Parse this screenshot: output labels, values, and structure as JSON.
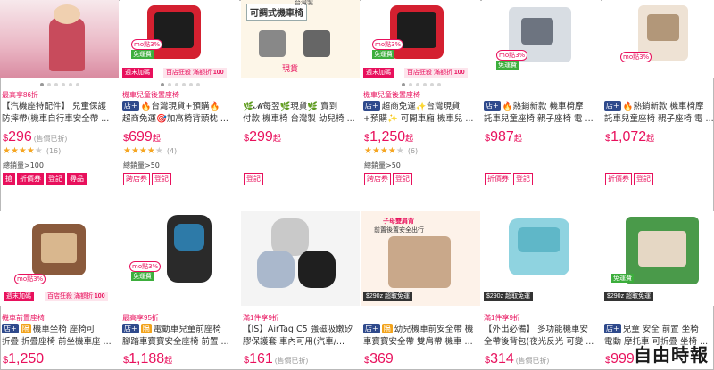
{
  "products": [
    {
      "promo": "最高享86折",
      "title_lines": [
        "【汽機座特配件】 兒童保護",
        "防摔帶(機車自行車安全帶 ..."
      ],
      "tag": "",
      "price": "296",
      "price_suffix": "",
      "price_note": "(售價已折)",
      "rating": 4,
      "review_count": "(16)",
      "sold": "總銷量>100",
      "badges": [
        "搶",
        "折價券",
        "登記",
        "尋品"
      ],
      "overlays": []
    },
    {
      "promo": "機車兒童後置座椅",
      "title_lines": [
        "超商免運🎯加高椅背頭枕 ..."
      ],
      "title_first": "🔥台灣現貨+預購🔥",
      "tag": "店+",
      "price": "699",
      "price_suffix": "起",
      "price_note": "",
      "rating": 4,
      "review_count": "(4)",
      "sold": "總銷量>50",
      "badges": [
        "跨店券",
        "登記"
      ],
      "overlays": [
        "mo點3%",
        "免運費",
        "週末加碼",
        "百店狂殺 滿額折",
        "100"
      ]
    },
    {
      "promo": "",
      "title_lines": [
        "🌿𝓜每翌🌿現貨🌿 賣到",
        "付款 機車椅 台灣製 幼兒椅 ..."
      ],
      "tag": "",
      "price": "299",
      "price_suffix": "起",
      "price_note": "",
      "rating": 0,
      "review_count": "",
      "sold": "",
      "badges": [
        "登記"
      ],
      "overlays": [
        "可調式機車椅",
        "台灣製",
        "現貨"
      ]
    },
    {
      "promo": "機車兒童後置座椅",
      "title_lines": [
        "+預購✨ 可開車廂 機車兒 ..."
      ],
      "title_first": "超商免運✨台灣現貨",
      "tag": "店+",
      "price": "1,250",
      "price_suffix": "起",
      "price_note": "",
      "rating": 4,
      "review_count": "(6)",
      "sold": "總銷量>50",
      "badges": [
        "跨店券",
        "登記"
      ],
      "overlays": [
        "mo點3%",
        "免運費",
        "週末加碼",
        "百店狂殺 滿額折",
        "100"
      ]
    },
    {
      "promo": "",
      "title_lines": [
        "託車兒童座椅 親子座椅 電 ..."
      ],
      "title_first": "🔥熱銷新款 機車椅摩",
      "tag": "店+",
      "price": "987",
      "price_suffix": "起",
      "price_note": "",
      "rating": 0,
      "review_count": "",
      "sold": "",
      "badges": [
        "折價券",
        "登記"
      ],
      "overlays": [
        "mo點3%",
        "免運費"
      ]
    },
    {
      "promo": "",
      "title_lines": [
        "託車兒童座椅 親子座椅 電 ..."
      ],
      "title_first": "🔥熱銷新款 機車椅摩",
      "tag": "店+",
      "price": "1,072",
      "price_suffix": "起",
      "price_note": "",
      "rating": 0,
      "review_count": "",
      "sold": "",
      "badges": [
        "折價券",
        "登記"
      ],
      "overlays": [
        "mo點3%"
      ]
    },
    {
      "promo": "機車前置座椅",
      "title_lines": [
        "折疊 折疊座椅 前坐機車座 ..."
      ],
      "title_first": "機車坐椅 座椅可",
      "tag": "店+",
      "tag2": "隔",
      "price": "1,250",
      "price_suffix": "",
      "price_note": "",
      "rating": 0,
      "review_count": "",
      "sold": "",
      "badges": [],
      "overlays": [
        "mo點3%",
        "週末加碼",
        "百店狂殺 滿額折",
        "100"
      ]
    },
    {
      "promo": "最高享95折",
      "title_lines": [
        "腳踏車寶寶安全座椅 前置 ..."
      ],
      "title_first": "電動車兒童前座椅",
      "tag": "店+",
      "tag2": "隔",
      "price": "1,188",
      "price_suffix": "起",
      "price_note": "",
      "rating": 0,
      "review_count": "",
      "sold": "",
      "badges": [],
      "overlays": [
        "mo點3%",
        "免運費"
      ]
    },
    {
      "promo": "滿1件享9折",
      "title_lines": [
        "【IS】AirTag C5 強磁吸嫩矽",
        "膠保護套 車內可用(汽車/..."
      ],
      "tag": "",
      "price": "161",
      "price_suffix": "",
      "price_note": "(售價已折)",
      "rating": 0,
      "review_count": "",
      "sold": "",
      "badges": [],
      "overlays": []
    },
    {
      "promo": "",
      "title_lines": [
        "車寶寶安全帶 雙肩帶 機車 ..."
      ],
      "title_first": "幼兒機車前安全帶 機",
      "tag": "店+",
      "tag2": "隔",
      "price": "369",
      "price_suffix": "",
      "price_note": "",
      "rating": 0,
      "review_count": "",
      "sold": "",
      "badges": [],
      "overlays": [
        "子母雙肩背",
        "前置後置安全出行",
        "$290z 超取免運"
      ]
    },
    {
      "promo": "滿1件享9折",
      "title_lines": [
        "【外出必備】 多功能機車安",
        "全帶後背包(夜光反光 可變 ..."
      ],
      "tag": "",
      "price": "314",
      "price_suffix": "",
      "price_note": "(售價已折)",
      "rating": 0,
      "review_count": "",
      "sold": "",
      "badges": [],
      "overlays": [
        "$290z 超取免運"
      ]
    },
    {
      "promo": "",
      "title_lines": [
        "電動 摩托車 可折疊 坐椅 ..."
      ],
      "title_first": "兒童 安全 前置 坐椅",
      "tag": "店+",
      "price": "999",
      "price_suffix": "",
      "price_note": "",
      "rating": 0,
      "review_count": "",
      "sold": "",
      "badges": [],
      "overlays": [
        "免運費",
        "$290z 超取免運"
      ]
    }
  ],
  "watermark": "自由時報",
  "colors": {
    "accent": "#e8105c",
    "star": "#f5a623",
    "tag_blue": "#2f4a8c",
    "tag_orange": "#f2a31b"
  },
  "icons": [
    "star-icon",
    "fire-icon"
  ]
}
